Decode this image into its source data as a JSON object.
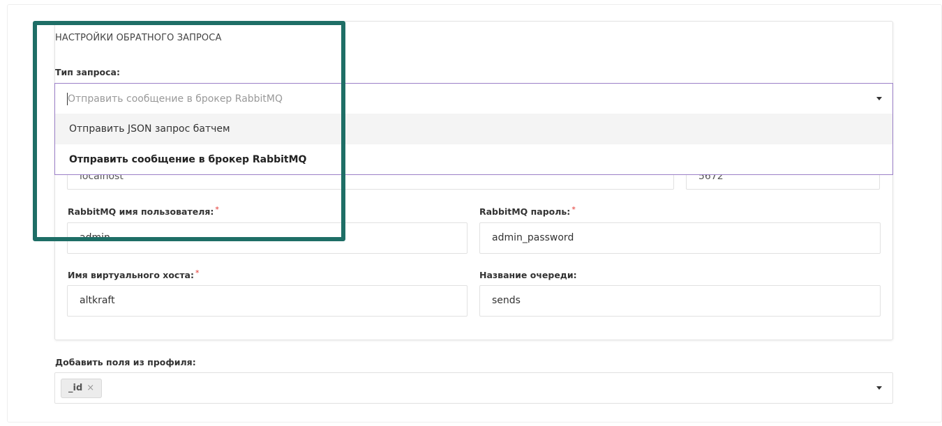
{
  "section": {
    "title": "НАСТРОЙКИ ОБРАТНОГО ЗАПРОСА"
  },
  "request_type": {
    "label": "Тип запроса:",
    "placeholder": "Отправить сообщение в брокер RabbitMQ",
    "options": [
      {
        "label": "Отправить JSON запрос батчем",
        "state": "hover"
      },
      {
        "label": "Отправить сообщение в брокер RabbitMQ",
        "state": "selected"
      }
    ]
  },
  "hidden_row": {
    "host_value": "localhost",
    "port_value": "5672"
  },
  "rabbit_user": {
    "label": "RabbitMQ имя пользователя:",
    "required_mark": "*",
    "value": "admin"
  },
  "rabbit_password": {
    "label": "RabbitMQ пароль:",
    "required_mark": "*",
    "value": "admin_password"
  },
  "vhost": {
    "label": "Имя виртуального хоста:",
    "required_mark": "*",
    "value": "altkraft"
  },
  "queue": {
    "label": "Название очереди:",
    "value": "sends"
  },
  "profile_fields": {
    "label": "Добавить поля из профиля:",
    "tags": [
      {
        "text": "_id",
        "remove_glyph": "×"
      }
    ]
  },
  "icons": {
    "dropdown_caret": "caret-down-icon",
    "tag_remove": "close-icon"
  },
  "colors": {
    "highlight": "#1e6e66",
    "focus_border": "#9b7fc7",
    "required": "#e3342f"
  }
}
